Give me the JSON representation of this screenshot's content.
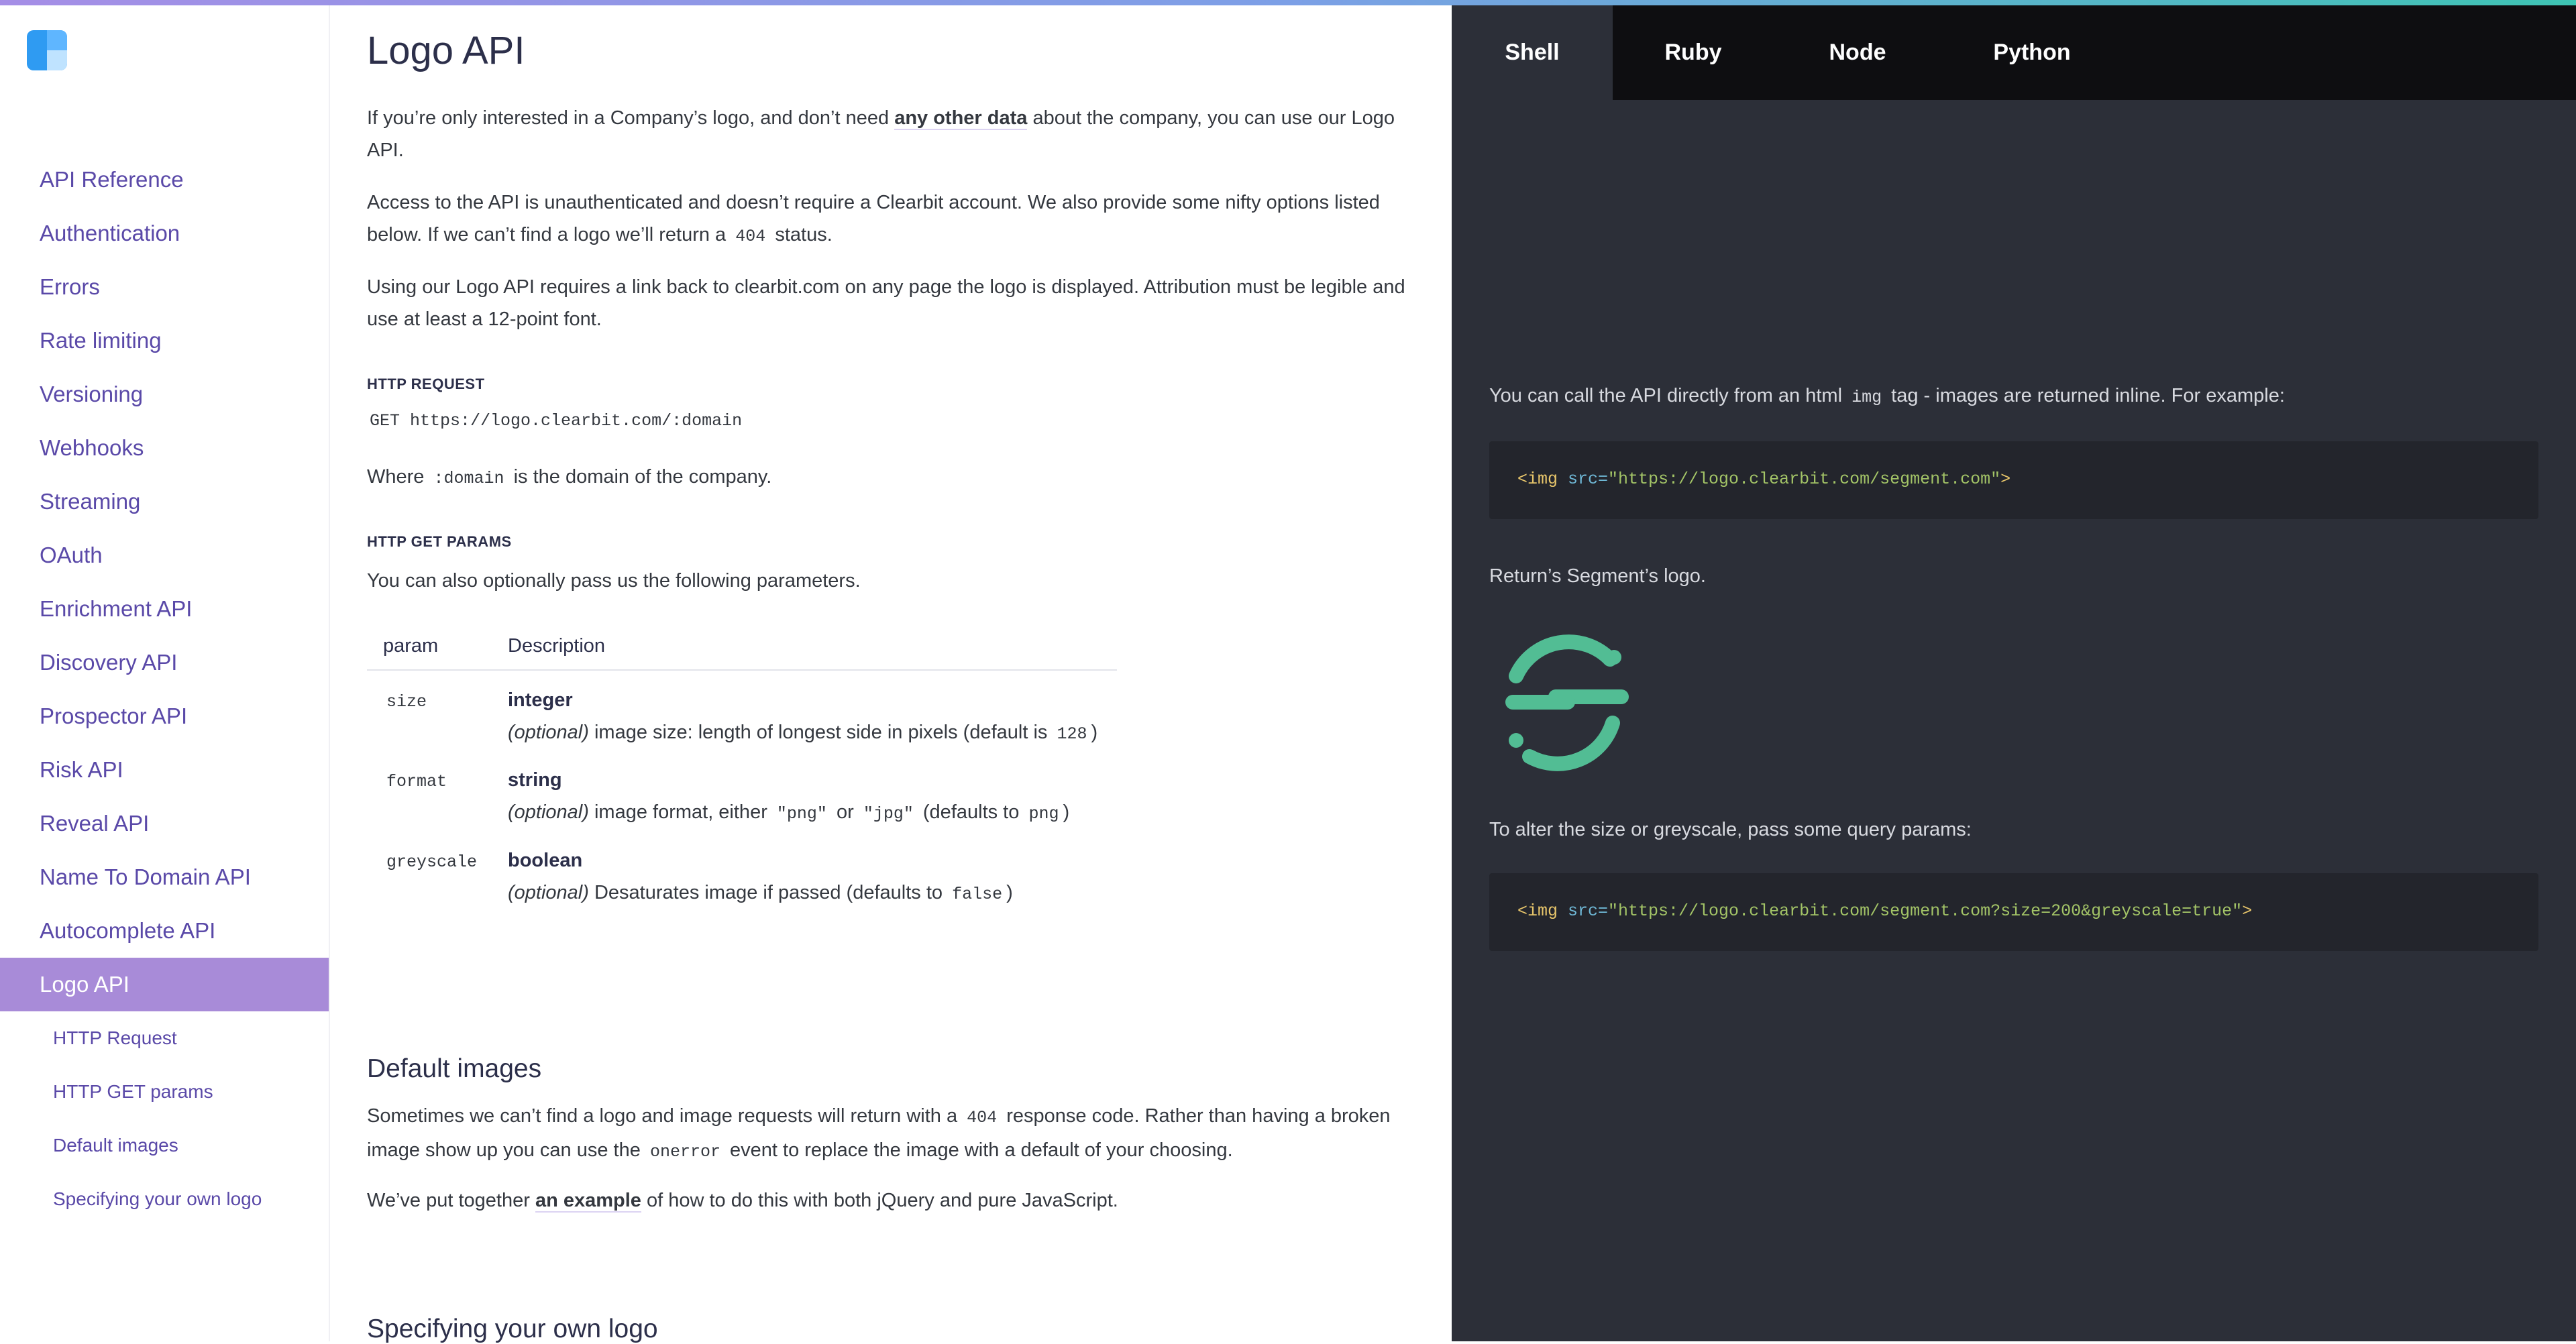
{
  "colors": {
    "accent": "#a88bd8",
    "link": "#5a49a8",
    "pane": "#2c2f38",
    "segment_green": "#52bd94"
  },
  "sidebar": {
    "logo_icon": "clearbit-logo",
    "items": [
      {
        "label": "API Reference"
      },
      {
        "label": "Authentication"
      },
      {
        "label": "Errors"
      },
      {
        "label": "Rate limiting"
      },
      {
        "label": "Versioning"
      },
      {
        "label": "Webhooks"
      },
      {
        "label": "Streaming"
      },
      {
        "label": "OAuth"
      },
      {
        "label": "Enrichment API"
      },
      {
        "label": "Discovery API"
      },
      {
        "label": "Prospector API"
      },
      {
        "label": "Risk API"
      },
      {
        "label": "Reveal API"
      },
      {
        "label": "Name To Domain API"
      },
      {
        "label": "Autocomplete API"
      },
      {
        "label": "Logo API"
      }
    ],
    "subitems": [
      {
        "label": "HTTP Request"
      },
      {
        "label": "HTTP GET params"
      },
      {
        "label": "Default images"
      },
      {
        "label": "Specifying your own logo"
      }
    ]
  },
  "main": {
    "title": "Logo API",
    "intro": {
      "p1_a": "If you’re only interested in a Company’s logo, and don’t need ",
      "p1_link": "any other data",
      "p1_b": " about the company, you can use our Logo API.",
      "p2_a": "Access to the API is unauthenticated and doesn’t require a Clearbit account. We also provide some nifty options listed below. If we can’t find a logo we’ll return a ",
      "p2_code": "404",
      "p2_b": " status.",
      "p3": "Using our Logo API requires a link back to clearbit.com on any page the logo is displayed. Attribution must be legible and use at least a 12-point font."
    },
    "http_request": {
      "label": "HTTP REQUEST",
      "request": "GET https://logo.clearbit.com/:domain",
      "where_a": "Where ",
      "where_code": ":domain",
      "where_b": " is the domain of the company."
    },
    "params": {
      "label": "HTTP GET PARAMS",
      "intro": "You can also optionally pass us the following parameters.",
      "headers": {
        "param": "param",
        "description": "Description"
      },
      "rows": [
        {
          "param": "size",
          "type": "integer",
          "optional": "(optional)",
          "desc_a": " image size: length of longest side in pixels (default is ",
          "code1": "128",
          "desc_b": ")"
        },
        {
          "param": "format",
          "type": "string",
          "optional": "(optional)",
          "desc_a": " image format, either ",
          "code1": "\"png\"",
          "mid": " or ",
          "code2": "\"jpg\"",
          "desc_b": " (defaults to ",
          "code3": "png",
          "desc_c": ")"
        },
        {
          "param": "greyscale",
          "type": "boolean",
          "optional": "(optional)",
          "desc_a": " Desaturates image if passed (defaults to ",
          "code1": "false",
          "desc_b": ")"
        }
      ]
    },
    "default_images": {
      "title": "Default images",
      "p1_a": "Sometimes we can’t find a logo and image requests will return with a ",
      "p1_code": "404",
      "p1_b": " response code. Rather than having a broken image show up you can use the ",
      "p1_code2": "onerror",
      "p1_c": " event to replace the image with a default of your choosing.",
      "p2_a": "We’ve put together ",
      "p2_link": "an example",
      "p2_b": " of how to do this with both jQuery and pure JavaScript."
    },
    "own_logo": {
      "title": "Specifying your own logo"
    }
  },
  "pane": {
    "tabs": [
      {
        "label": "Shell"
      },
      {
        "label": "Ruby"
      },
      {
        "label": "Node"
      },
      {
        "label": "Python"
      }
    ],
    "call_text_a": "You can call the API directly from an html ",
    "call_text_code": "img",
    "call_text_b": " tag - images are returned inline. For example:",
    "code1": {
      "tag": "<img",
      "attr": " src=",
      "str": "\"https://logo.clearbit.com/segment.com\"",
      "end": ">"
    },
    "returns_text": "Return’s Segment’s logo.",
    "segment_logo_icon": "segment-logo",
    "alter_text": "To alter the size or greyscale, pass some query params:",
    "code2": {
      "tag": "<img",
      "attr": " src=",
      "str": "\"https://logo.clearbit.com/segment.com?size=200&greyscale=true\"",
      "end": ">"
    }
  }
}
